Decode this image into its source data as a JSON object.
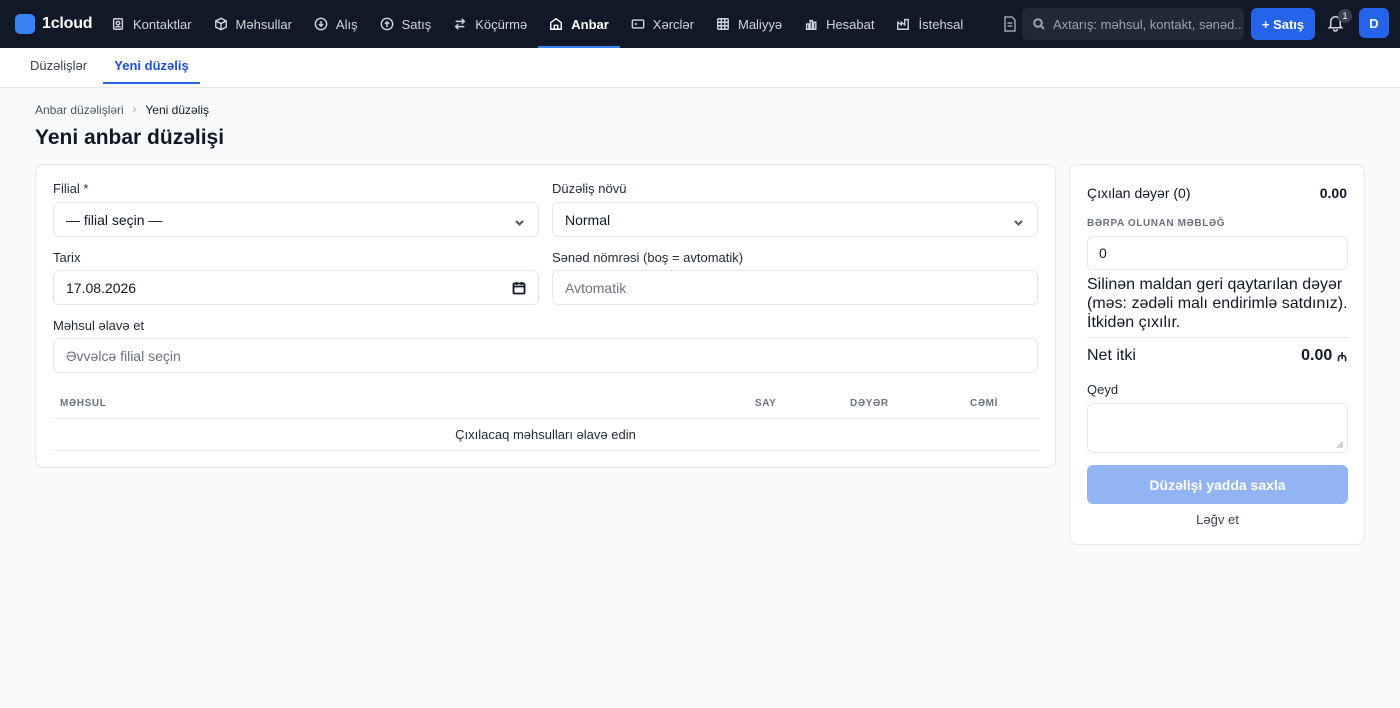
{
  "app": {
    "name": "1cloud"
  },
  "nav": {
    "items": [
      {
        "label": "Kontaktlar",
        "icon": "contacts-icon"
      },
      {
        "label": "Məhsullar",
        "icon": "box-icon"
      },
      {
        "label": "Alış",
        "icon": "download-circle-icon"
      },
      {
        "label": "Satış",
        "icon": "upload-circle-icon"
      },
      {
        "label": "Köçürmə",
        "icon": "transfer-icon"
      },
      {
        "label": "Anbar",
        "icon": "warehouse-icon",
        "active": true
      },
      {
        "label": "Xərclər",
        "icon": "wallet-icon"
      },
      {
        "label": "Maliyyə",
        "icon": "grid-icon"
      },
      {
        "label": "Hesabat",
        "icon": "bar-chart-icon"
      },
      {
        "label": "İstehsal",
        "icon": "factory-icon"
      }
    ],
    "search_placeholder": "Axtarış: məhsul, kontakt, sənəd...",
    "new_sale_label": "+ Satış",
    "notification_count": "1",
    "avatar_initial": "D"
  },
  "subtabs": {
    "adjustments": "Düzəlişlər",
    "new_adjustment": "Yeni düzəliş"
  },
  "breadcrumb": {
    "parent": "Anbar düzəlişləri",
    "current": "Yeni düzəliş"
  },
  "page": {
    "title": "Yeni anbar düzəlişi"
  },
  "form": {
    "branch_label": "Filial *",
    "branch_value": "— filial seçin —",
    "type_label": "Düzəliş növü",
    "type_value": "Normal",
    "date_label": "Tarix",
    "date_value": "17.08.2026",
    "doc_number_label": "Sənəd nömrəsi (boş = avtomatik)",
    "doc_number_placeholder": "Avtomatik",
    "add_product_label": "Məhsul əlavə et",
    "add_product_placeholder": "Əvvəlcə filial seçin"
  },
  "table": {
    "columns": {
      "product": "MƏHSUL",
      "qty": "SAY",
      "value": "DƏYƏR",
      "total": "CƏMİ"
    },
    "empty_text": "Çıxılacaq məhsulları əlavə edin"
  },
  "summary": {
    "outgoing_label": "Çıxılan dəyər (0)",
    "outgoing_value": "0.00",
    "recovered_caption": "BƏRPA OLUNAN MƏBLƏĞ",
    "recovered_value": "0",
    "recovered_note": "Silinən maldan geri qaytarılan dəyər (məs: zədəli malı endirimlə satdınız). İtkidən çıxılır.",
    "net_loss_label": "Net itki",
    "net_loss_value": "0.00",
    "currency_symbol": "₼",
    "note_label": "Qeyd",
    "save_label": "Düzəlişi yadda saxla",
    "cancel_label": "Ləğv et"
  },
  "colors": {
    "topbar": "#111827",
    "accent": "#2563eb",
    "save_disabled": "#93b4f3"
  }
}
